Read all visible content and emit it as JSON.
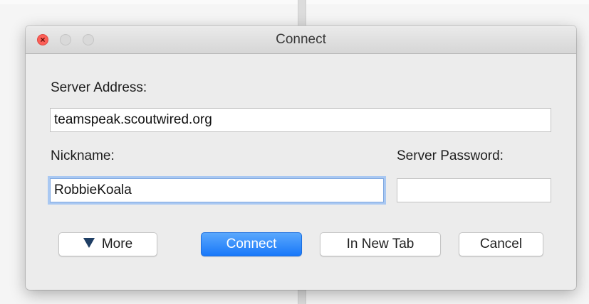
{
  "window": {
    "title": "Connect"
  },
  "form": {
    "server_address_label": "Server Address:",
    "server_address_value": "teamspeak.scoutwired.org",
    "nickname_label": "Nickname:",
    "nickname_value": "RobbieKoala",
    "server_password_label": "Server Password:",
    "server_password_value": ""
  },
  "buttons": {
    "more": "More",
    "connect": "Connect",
    "new_tab": "In New Tab",
    "cancel": "Cancel"
  },
  "icons": {
    "close": "close-icon",
    "more_toggle": "triangle-down-icon"
  },
  "colors": {
    "primary_button": "#1978f9",
    "close_button": "#fc5f57",
    "focus_ring": "#a9c8f2"
  }
}
